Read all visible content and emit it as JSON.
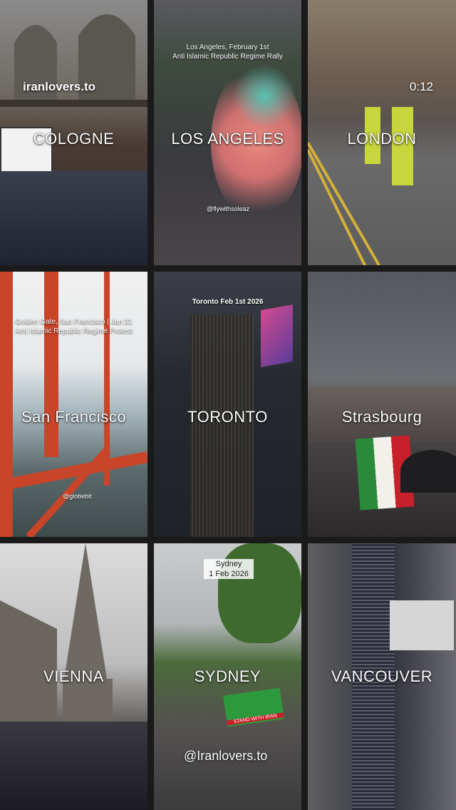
{
  "overlay": {
    "site": "iranlovers.to",
    "timer": "0:12",
    "handle": "@Iranlovers.to"
  },
  "tiles": [
    {
      "label": "COLOGNE"
    },
    {
      "label": "LOS ANGELES",
      "caption": "Los Angeles, February 1st\nAnti Islamic Republic Regime Rally",
      "watermark": "@flywithsoleaz"
    },
    {
      "label": "LONDON"
    },
    {
      "label": "San Francisco",
      "caption": "Golden Gate, San Francisco | Jan 31\nAnti Islamic Republic Regime Protest",
      "watermark": "@globebit"
    },
    {
      "label": "TORONTO",
      "caption": "Toronto Feb 1st 2026"
    },
    {
      "label": "Strasbourg"
    },
    {
      "label": "VIENNA"
    },
    {
      "label": "SYDNEY",
      "caption": "Sydney\n1 Feb 2026",
      "banner": "STAND WITH IRAN"
    },
    {
      "label": "VANCOUVER"
    }
  ],
  "colors": {
    "divider": "#1a1a1a",
    "text": "#ffffff"
  }
}
